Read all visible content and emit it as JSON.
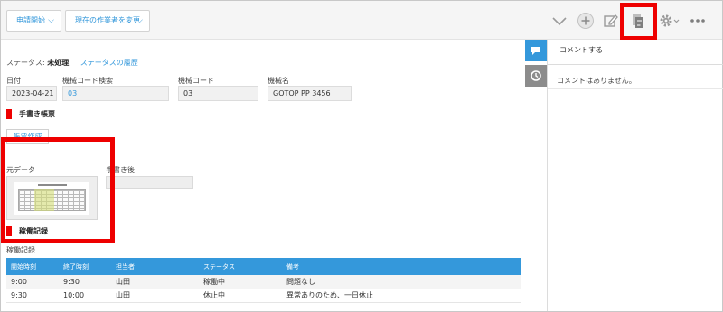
{
  "header": {
    "start_application_label": "申請開始",
    "change_assignee_label": "現在の作業者を変更"
  },
  "record": {
    "status_label": "ステータス:",
    "status_value": "未処理",
    "status_history_label": "ステータスの履歴",
    "fields": {
      "date": {
        "label": "日付",
        "value": "2023-04-21"
      },
      "machine_code_search": {
        "label": "機械コード検索",
        "value": "03"
      },
      "machine_code": {
        "label": "機械コード",
        "value": "03"
      },
      "machine_name": {
        "label": "機械名",
        "value": "GOTOP PP 3456"
      }
    },
    "handwritten_form_section": "手書き帳票",
    "create_form_button": "帳票作成",
    "original_data_label": "元データ",
    "after_handwriting_label": "手書き後",
    "operation_log_section": "稼働記録",
    "operation_table": {
      "title": "稼働記録",
      "columns": [
        "開始時刻",
        "終了時刻",
        "担当者",
        "ステータス",
        "備考"
      ],
      "rows": [
        [
          "9:00",
          "9:30",
          "山田",
          "稼働中",
          "問題なし"
        ],
        [
          "9:30",
          "10:00",
          "山田",
          "休止中",
          "異常ありのため、一日休止"
        ]
      ]
    }
  },
  "sidebar": {
    "comment_title": "コメントする",
    "no_comments": "コメントはありません。"
  },
  "colors": {
    "accent": "#3498db",
    "highlight": "#ee0000"
  }
}
